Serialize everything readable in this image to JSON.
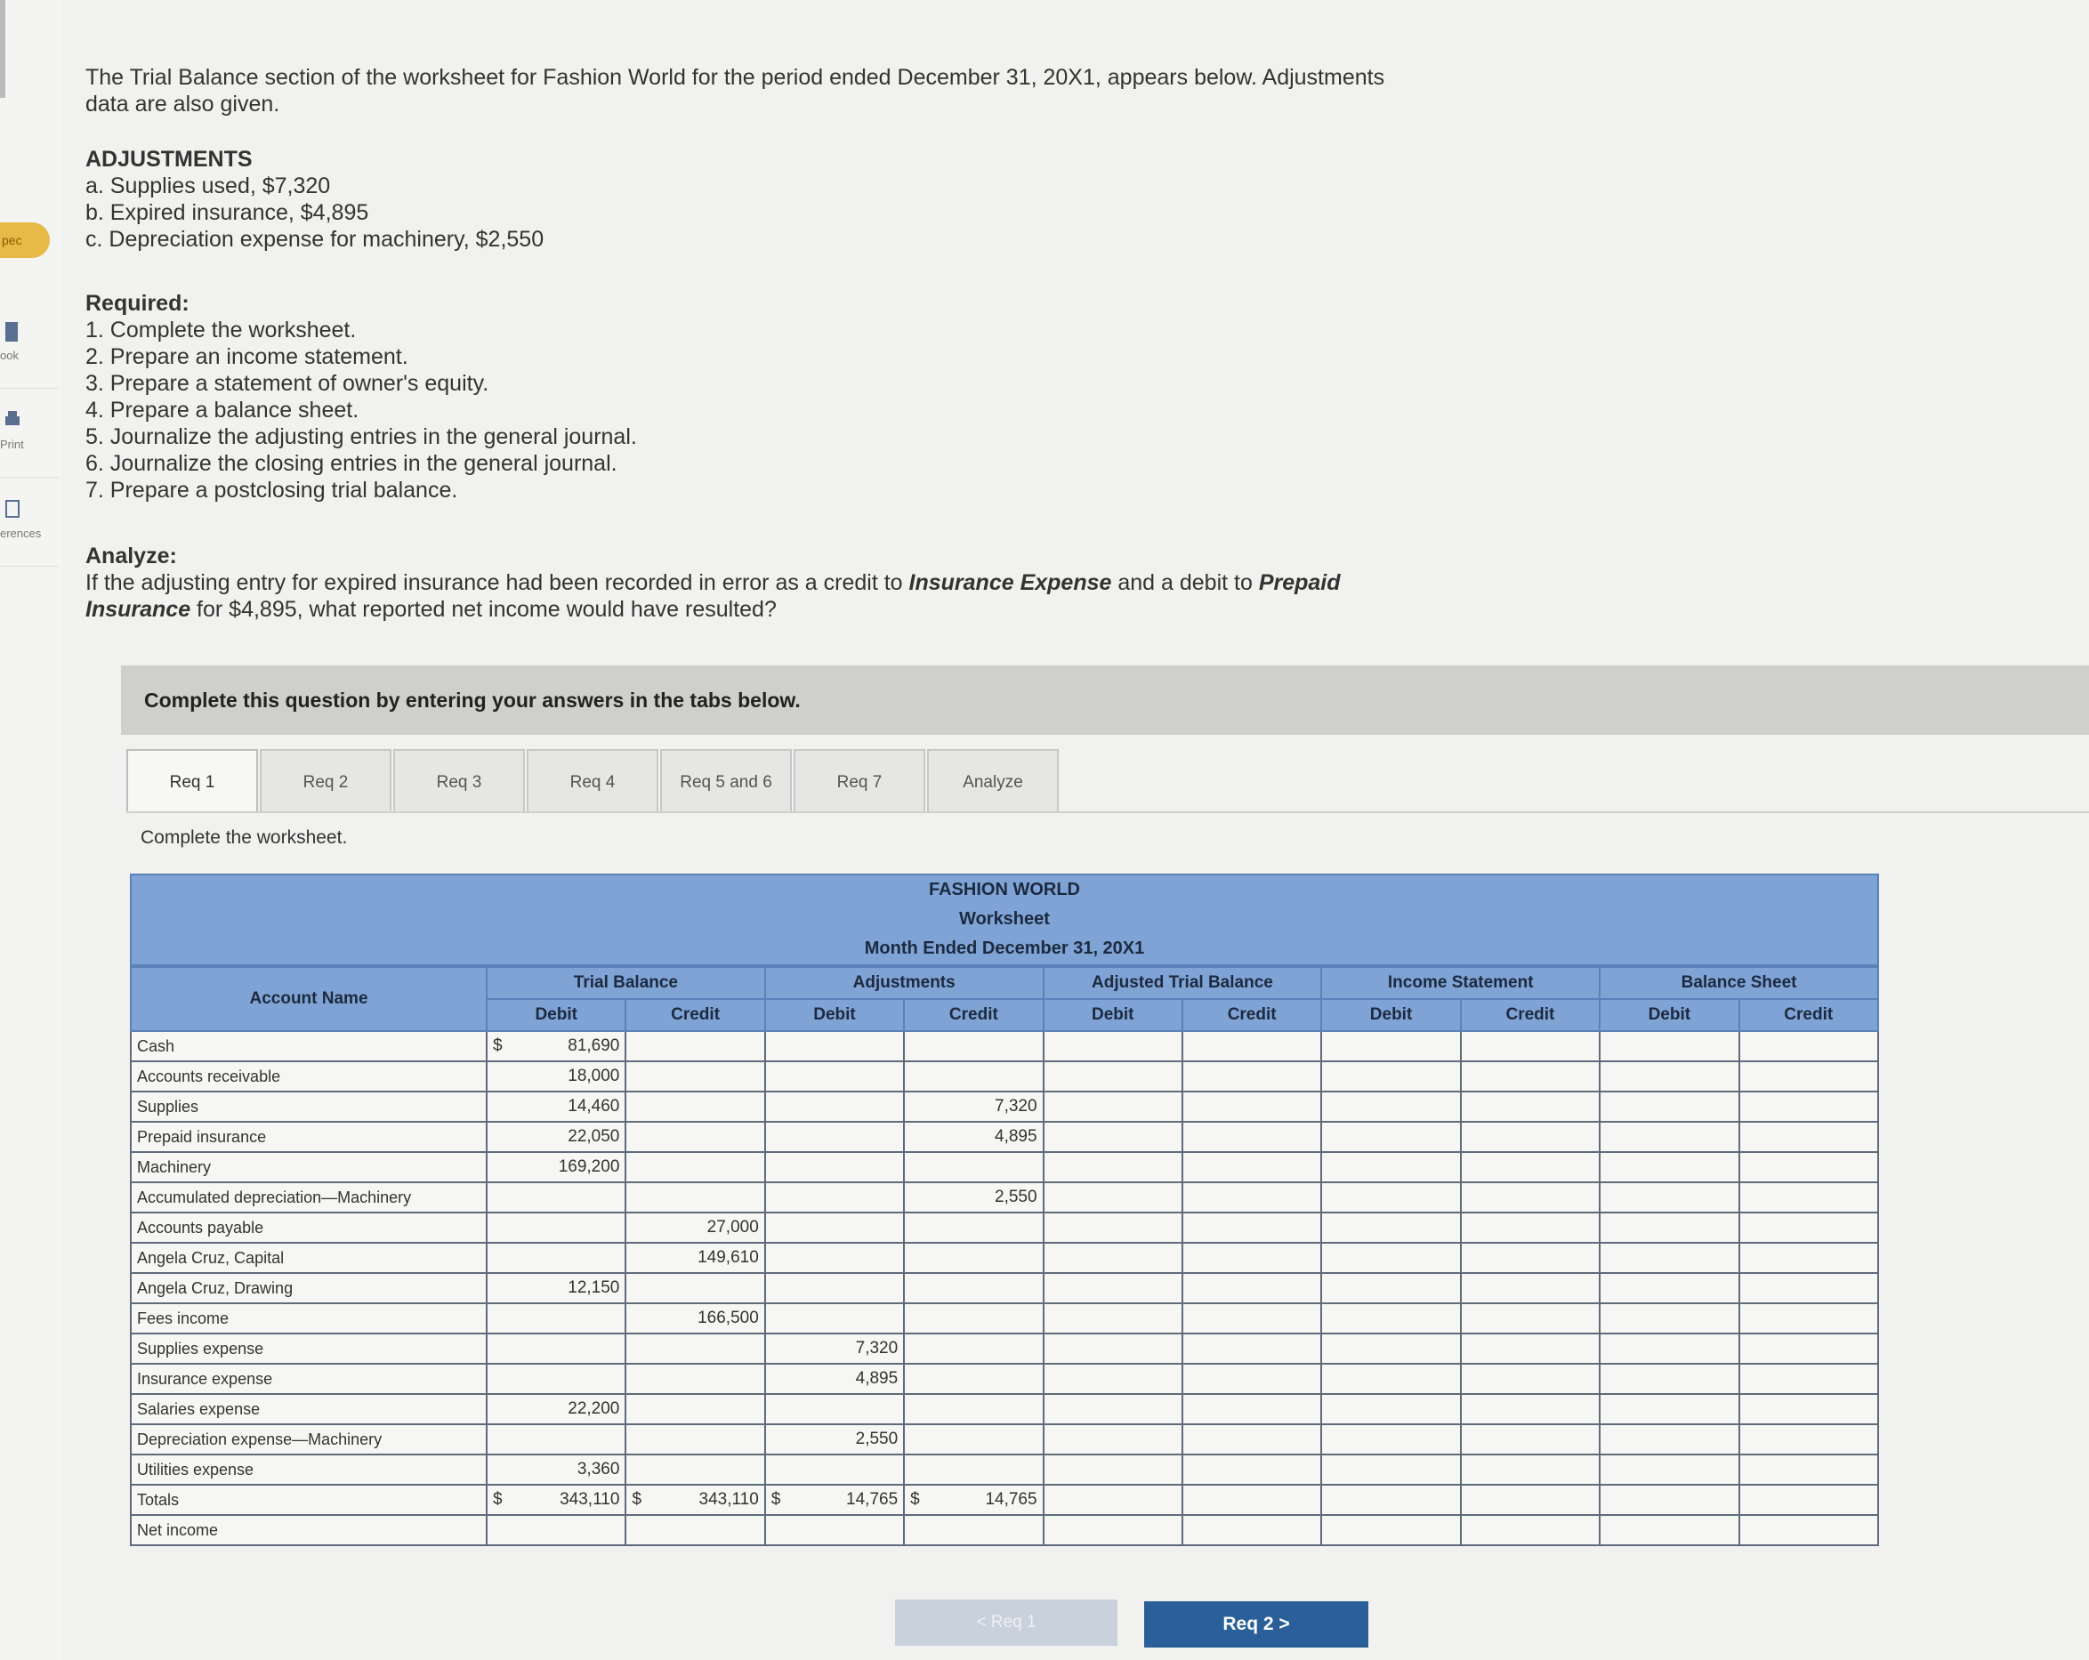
{
  "sidebar": {
    "badge": "pec",
    "items": [
      {
        "label": "ook",
        "icon": "book-icon"
      },
      {
        "label": "Print",
        "icon": "printer-icon"
      },
      {
        "label": "erences",
        "icon": "references-icon"
      }
    ]
  },
  "problem": {
    "intro": "The Trial Balance section of the worksheet for Fashion World for the period ended December 31, 20X1, appears below. Adjustments data are also given.",
    "adjustments_heading": "ADJUSTMENTS",
    "adjustments": [
      "a. Supplies used, $7,320",
      "b. Expired insurance, $4,895",
      "c. Depreciation expense for machinery, $2,550"
    ],
    "required_heading": "Required:",
    "required": [
      "1. Complete the worksheet.",
      "2. Prepare an income statement.",
      "3. Prepare a statement of owner's equity.",
      "4. Prepare a balance sheet.",
      "5. Journalize the adjusting entries in the general journal.",
      "6. Journalize the closing entries in the general journal.",
      "7. Prepare a postclosing trial balance."
    ],
    "analyze_heading": "Analyze:",
    "analyze_text_1": "If the adjusting entry for expired insurance had been recorded in error as a credit to ",
    "analyze_em_1": "Insurance Expense",
    "analyze_text_2": " and a debit to ",
    "analyze_em_2": "Prepaid Insurance",
    "analyze_text_3": " for $4,895, what reported net income would have resulted?"
  },
  "instruction_bar": "Complete this question by entering your answers in the tabs below.",
  "tabs": [
    "Req 1",
    "Req 2",
    "Req 3",
    "Req 4",
    "Req 5 and 6",
    "Req 7",
    "Analyze"
  ],
  "active_tab": "Req 1",
  "sub_instruction": "Complete the worksheet.",
  "worksheet": {
    "company": "FASHION WORLD",
    "title": "Worksheet",
    "period": "Month Ended December 31, 20X1",
    "account_header": "Account Name",
    "groups": [
      "Trial Balance",
      "Adjustments",
      "Adjusted Trial Balance",
      "Income Statement",
      "Balance Sheet"
    ],
    "debit_label": "Debit",
    "credit_label": "Credit",
    "currency": "$",
    "rows": [
      {
        "account": "Cash",
        "tb_debit": "81,690",
        "tb_credit": "",
        "adj_debit": "",
        "adj_credit": "",
        "tb_debit_cur": "$"
      },
      {
        "account": "Accounts receivable",
        "tb_debit": "18,000",
        "tb_credit": "",
        "adj_debit": "",
        "adj_credit": ""
      },
      {
        "account": "Supplies",
        "tb_debit": "14,460",
        "tb_credit": "",
        "adj_debit": "",
        "adj_credit": "7,320"
      },
      {
        "account": "Prepaid insurance",
        "tb_debit": "22,050",
        "tb_credit": "",
        "adj_debit": "",
        "adj_credit": "4,895"
      },
      {
        "account": "Machinery",
        "tb_debit": "169,200",
        "tb_credit": "",
        "adj_debit": "",
        "adj_credit": ""
      },
      {
        "account": "Accumulated depreciation—Machinery",
        "tb_debit": "",
        "tb_credit": "",
        "adj_debit": "",
        "adj_credit": "2,550"
      },
      {
        "account": "Accounts payable",
        "tb_debit": "",
        "tb_credit": "27,000",
        "adj_debit": "",
        "adj_credit": ""
      },
      {
        "account": "Angela Cruz, Capital",
        "tb_debit": "",
        "tb_credit": "149,610",
        "adj_debit": "",
        "adj_credit": ""
      },
      {
        "account": "Angela Cruz, Drawing",
        "tb_debit": "12,150",
        "tb_credit": "",
        "adj_debit": "",
        "adj_credit": ""
      },
      {
        "account": "Fees income",
        "tb_debit": "",
        "tb_credit": "166,500",
        "adj_debit": "",
        "adj_credit": ""
      },
      {
        "account": "Supplies expense",
        "tb_debit": "",
        "tb_credit": "",
        "adj_debit": "7,320",
        "adj_credit": ""
      },
      {
        "account": "Insurance expense",
        "tb_debit": "",
        "tb_credit": "",
        "adj_debit": "4,895",
        "adj_credit": ""
      },
      {
        "account": "Salaries expense",
        "tb_debit": "22,200",
        "tb_credit": "",
        "adj_debit": "",
        "adj_credit": ""
      },
      {
        "account": "Depreciation expense—Machinery",
        "tb_debit": "",
        "tb_credit": "",
        "adj_debit": "2,550",
        "adj_credit": ""
      },
      {
        "account": "Utilities expense",
        "tb_debit": "3,360",
        "tb_credit": "",
        "adj_debit": "",
        "adj_credit": ""
      }
    ],
    "totals": {
      "label": "Totals",
      "tb_debit": "343,110",
      "tb_credit": "343,110",
      "adj_debit": "14,765",
      "adj_credit": "14,765"
    },
    "net_income_label": "Net income"
  },
  "nav": {
    "prev": "< Req 1",
    "next": "Req 2  >"
  }
}
